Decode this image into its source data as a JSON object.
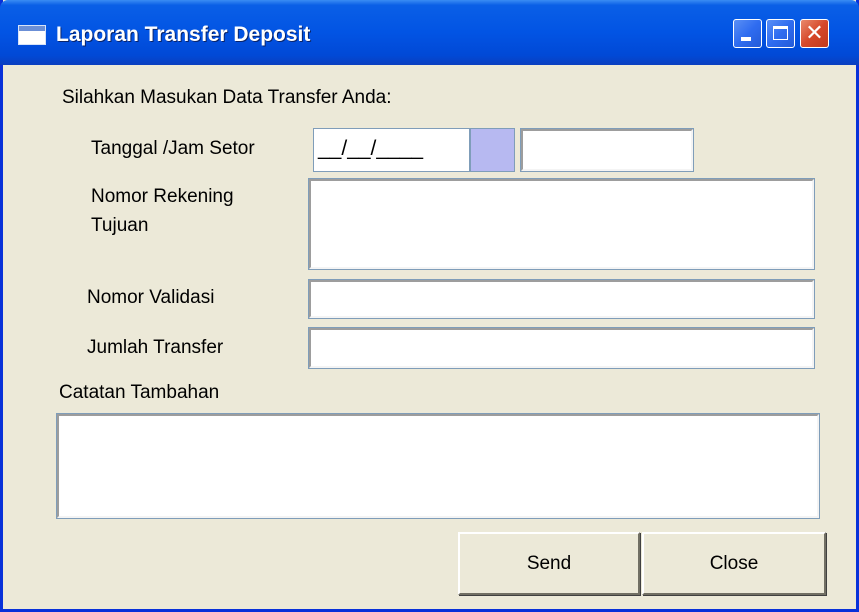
{
  "window": {
    "title": "Laporan Transfer Deposit",
    "icons": {
      "app": "app-window-icon",
      "minimize": "minimize-icon",
      "maximize": "maximize-icon",
      "close": "close-icon"
    }
  },
  "form": {
    "instruction": "Silahkan Masukan Data Transfer Anda:",
    "tanggal_label": "Tanggal /Jam Setor",
    "date_mask": "__/__/____",
    "time_value": "",
    "rekening_label_line1": "Nomor Rekening",
    "rekening_label_line2": "Tujuan",
    "rekening_value": "",
    "validasi_label": "Nomor Validasi",
    "validasi_value": "",
    "jumlah_label": "Jumlah Transfer",
    "jumlah_value": "",
    "catatan_label": "Catatan Tambahan",
    "catatan_value": ""
  },
  "buttons": {
    "send": "Send",
    "close": "Close"
  },
  "colors": {
    "title_bar": "#0254e4",
    "window_bg": "#ece9d8",
    "spin_button": "#b7b9f1",
    "close_button": "#d6482a"
  }
}
